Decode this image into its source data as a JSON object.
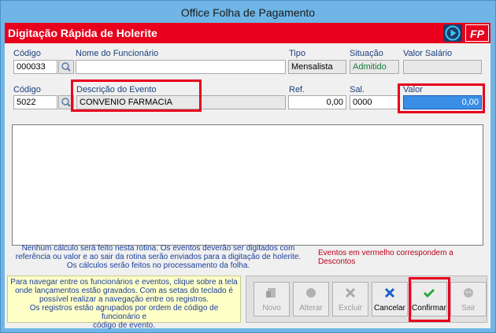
{
  "window": {
    "title": "Office Folha de Pagamento"
  },
  "header": {
    "title": "Digitação Rápida de Holerite",
    "logo_text": "FP",
    "brand_color": "#e8001c"
  },
  "employee": {
    "code_label": "Código",
    "code_value": "000033",
    "name_label": "Nome do Funcionário",
    "name_value": "",
    "tipo_label": "Tipo",
    "tipo_value": "Mensalista",
    "situacao_label": "Situação",
    "situacao_value": "Admitido",
    "salario_label": "Valor Salário",
    "salario_value": ""
  },
  "event": {
    "code_label": "Código",
    "code_value": "5022",
    "desc_label": "Descrição do Evento",
    "desc_value": "CONVENIO FARMACIA",
    "ref_label": "Ref.",
    "ref_value": "0,00",
    "sal_label": "Sal.",
    "sal_value": "0000",
    "valor_label": "Valor",
    "valor_value": "0,00"
  },
  "notes": {
    "blue_line1": "Nenhum cálculo será feito nesta rotina. Os eventos deverão ser digitados com",
    "blue_line2": "referência ou valor e ao sair da rotina serão enviados para a digitação de holerite.",
    "blue_line3": "Os cálculos serão feitos no processamento da folha.",
    "red": "Eventos em vermelho correspondem a Descontos"
  },
  "help": {
    "line1": "Para navegar entre os funcionários e eventos, clique sobre a tela",
    "line2": "onde lançamentos estão gravados. Com as setas do teclado é",
    "line3": "possível realizar a navegação entre os registros.",
    "line4": "Os registros estão agrupados por ordem de código de funcionário e",
    "line5": "código de evento."
  },
  "buttons": {
    "novo": "Novo",
    "alterar": "Alterar",
    "excluir": "Excluir",
    "cancelar": "Cancelar",
    "confirmar": "Confirmar",
    "sair": "Sair"
  }
}
